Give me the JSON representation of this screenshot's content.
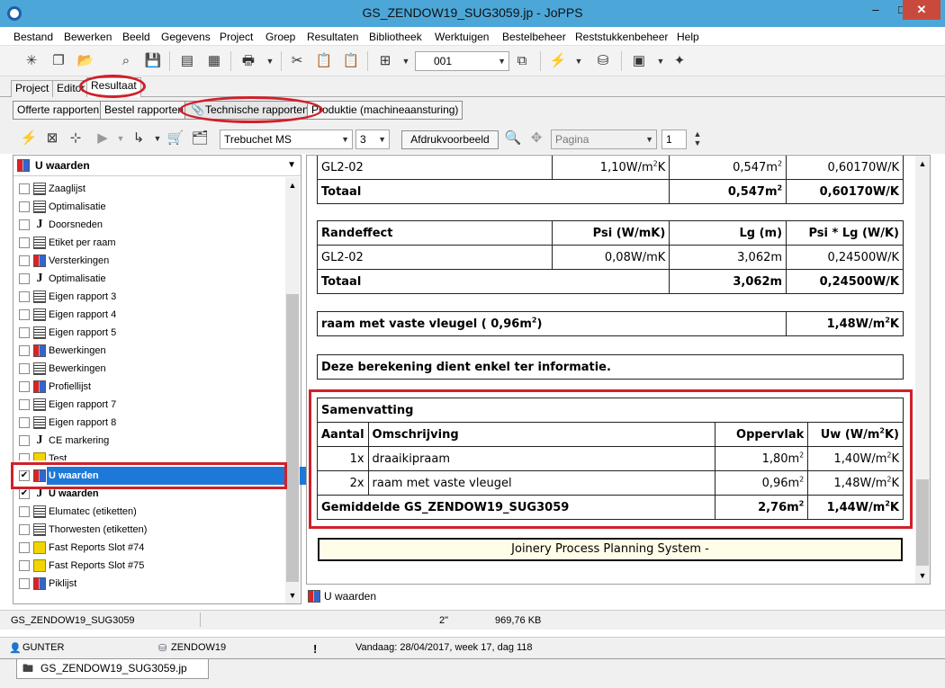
{
  "window": {
    "title": "GS_ZENDOW19_SUG3059.jp - JoPPS",
    "minimize": "–",
    "maximize": "□",
    "close": "✕"
  },
  "menu": [
    "Bestand",
    "Bewerken",
    "Beeld",
    "Gegevens",
    "Project",
    "Groep",
    "Resultaten",
    "Bibliotheek",
    "Werktuigen",
    "Bestelbeheer",
    "Reststukkenbeheer",
    "Help"
  ],
  "toolbar": {
    "view_select": "001"
  },
  "tabs": [
    "Project",
    "Editor",
    "Resultaat"
  ],
  "report_tabs": [
    "Offerte rapporten",
    "Bestel rapporten",
    "Technische rapporten",
    "Produktie (machineaansturing)"
  ],
  "report_toolbar": {
    "font": "Trebuchet MS",
    "size": "3",
    "preview": "Afdrukvoorbeeld",
    "page_label": "Pagina",
    "page_number": "1"
  },
  "left_panel": {
    "header": "U waarden",
    "items": [
      {
        "label": "Zaaglijst",
        "icon": "list-icon",
        "checked": false
      },
      {
        "label": "Optimalisatie",
        "icon": "list-icon",
        "checked": false
      },
      {
        "label": "Doorsneden",
        "icon": "j-icon",
        "checked": false
      },
      {
        "label": "Etiket per raam",
        "icon": "list-icon",
        "checked": false
      },
      {
        "label": "Versterkingen",
        "icon": "report-icon",
        "checked": false
      },
      {
        "label": "Optimalisatie",
        "icon": "j-icon",
        "checked": false
      },
      {
        "label": "Eigen rapport 3",
        "icon": "doc-icon",
        "checked": false
      },
      {
        "label": "Eigen rapport 4",
        "icon": "doc-icon",
        "checked": false
      },
      {
        "label": "Eigen rapport 5",
        "icon": "doc-icon",
        "checked": false
      },
      {
        "label": "Bewerkingen",
        "icon": "report-icon",
        "checked": false
      },
      {
        "label": "Bewerkingen",
        "icon": "doc-icon",
        "checked": false
      },
      {
        "label": "Profiellijst",
        "icon": "report-icon",
        "checked": false
      },
      {
        "label": "Eigen rapport 7",
        "icon": "doc-icon",
        "checked": false
      },
      {
        "label": "Eigen rapport 8",
        "icon": "doc-icon",
        "checked": false
      },
      {
        "label": "CE markering",
        "icon": "j-icon",
        "checked": false
      },
      {
        "label": "Test",
        "icon": "fastreport-icon",
        "checked": false
      },
      {
        "label": "U waarden",
        "icon": "report-icon",
        "checked": true
      },
      {
        "label": "U waarden",
        "icon": "j-icon",
        "checked": true
      },
      {
        "label": "Elumatec (etiketten)",
        "icon": "list-icon",
        "checked": false
      },
      {
        "label": "Thorwesten (etiketten)",
        "icon": "list-icon",
        "checked": false
      },
      {
        "label": "Fast Reports Slot #74",
        "icon": "fastreport-icon",
        "checked": false
      },
      {
        "label": "Fast Reports Slot #75",
        "icon": "fastreport-icon",
        "checked": false
      },
      {
        "label": "Piklijst",
        "icon": "report-icon",
        "checked": false
      }
    ]
  },
  "report": {
    "glass_row": {
      "name": "GL2-02",
      "u": "1,10W/m",
      "area": "0,547m",
      "total": "0,60170W/K"
    },
    "glass_total": {
      "label": "Totaal",
      "area": "0,547m",
      "total": "0,60170W/K"
    },
    "edge": {
      "headers": [
        "Randeffect",
        "Psi (W/mK)",
        "Lg (m)",
        "Psi * Lg (W/K)"
      ],
      "row": {
        "name": "GL2-02",
        "psi": "0,08W/mK",
        "lg": "3,062m",
        "total": "0,24500W/K"
      },
      "total": {
        "label": "Totaal",
        "lg": "3,062m",
        "total": "0,24500W/K"
      }
    },
    "window_line": {
      "label": "raam met vaste vleugel  ( 0,96m",
      "label_end": ")",
      "value": "1,48W/m",
      "value_end": "K"
    },
    "info": "Deze berekening dient enkel ter informatie.",
    "summary": {
      "title": "Samenvatting",
      "headers": {
        "count": "Aantal",
        "desc": "Omschrijving",
        "area": "Oppervlak",
        "uw": "Uw (W/m",
        "uw_end": "K)"
      },
      "rows": [
        {
          "count": "1x",
          "desc": "draaikipraam",
          "area": "1,80m",
          "uw": "1,40W/m",
          "uw_end": "K"
        },
        {
          "count": "2x",
          "desc": "raam met vaste vleugel",
          "area": "0,96m",
          "uw": "1,48W/m",
          "uw_end": "K"
        }
      ],
      "average": {
        "label": "Gemiddelde GS_ZENDOW19_SUG3059",
        "area": "2,76m",
        "uw": "1,44W/m",
        "uw_end": "K"
      }
    },
    "sup2": "2",
    "footer": "Joinery Process Planning System -"
  },
  "bottom_label": "U waarden",
  "status1": {
    "file": "GS_ZENDOW19_SUG3059",
    "size_label": "2\"",
    "filesize": "969,76 KB"
  },
  "status2": {
    "user": "GUNTER",
    "db": "ZENDOW19",
    "alert": "!",
    "date": "Vandaag: 28/04/2017, week 17, dag 118"
  },
  "doc_tab": "GS_ZENDOW19_SUG3059.jp",
  "colors": {
    "accent": "#1e78d7",
    "highlight": "#d0202a",
    "titlebar": "#4ca7d8"
  }
}
